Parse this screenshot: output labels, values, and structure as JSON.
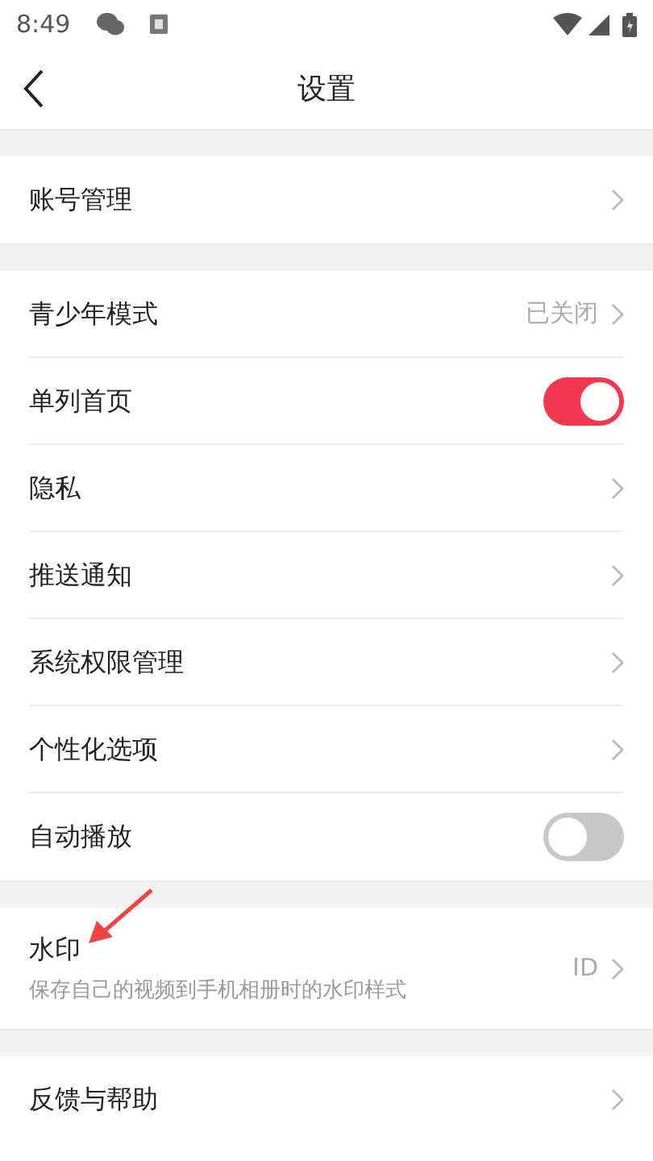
{
  "status_bar": {
    "time": "8:49"
  },
  "header": {
    "title": "设置"
  },
  "sections": [
    {
      "items": [
        {
          "kind": "link",
          "label": "账号管理"
        }
      ]
    },
    {
      "items": [
        {
          "kind": "link",
          "label": "青少年模式",
          "value": "已关闭"
        },
        {
          "kind": "toggle",
          "label": "单列首页",
          "on": true
        },
        {
          "kind": "link",
          "label": "隐私"
        },
        {
          "kind": "link",
          "label": "推送通知"
        },
        {
          "kind": "link",
          "label": "系统权限管理"
        },
        {
          "kind": "link",
          "label": "个性化选项"
        },
        {
          "kind": "toggle",
          "label": "自动播放",
          "on": false
        }
      ]
    },
    {
      "items": [
        {
          "kind": "link",
          "label": "水印",
          "subtitle": "保存自己的视频到手机相册时的水印样式",
          "value": "ID",
          "annotated": true
        }
      ]
    },
    {
      "items": [
        {
          "kind": "link",
          "label": "反馈与帮助"
        }
      ]
    }
  ]
}
